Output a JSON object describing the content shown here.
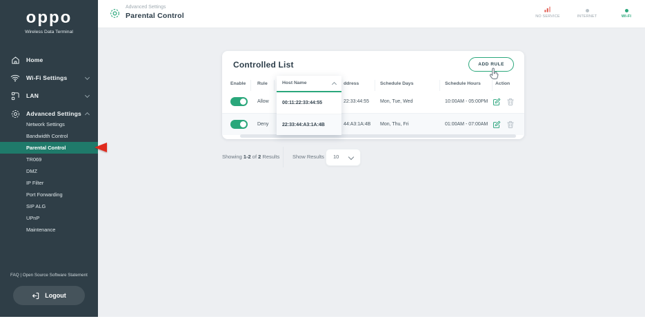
{
  "brand": {
    "logo": "oppo",
    "tagline": "Wireless Data Terminal"
  },
  "header": {
    "breadcrumb": "Advanced Settings",
    "title": "Parental Control",
    "status": [
      {
        "label": "NO SERVICE"
      },
      {
        "label": "INTERNET"
      },
      {
        "label": "WI-FI"
      }
    ]
  },
  "sidebar": {
    "menu": [
      {
        "label": "Home"
      },
      {
        "label": "Wi-Fi Settings"
      },
      {
        "label": "LAN"
      },
      {
        "label": "Advanced Settings"
      }
    ],
    "submenu": [
      {
        "label": "Network Settings"
      },
      {
        "label": "Bandwidth Control"
      },
      {
        "label": "Parental Control",
        "active": true
      },
      {
        "label": "TR069"
      },
      {
        "label": "DMZ"
      },
      {
        "label": "IP Filter"
      },
      {
        "label": "Port Forwarding"
      },
      {
        "label": "SIP ALG"
      },
      {
        "label": "UPnP"
      },
      {
        "label": "Maintenance"
      }
    ],
    "footer_link": "FAQ | Open Source Software Statement",
    "logout_label": "Logout"
  },
  "content": {
    "card_title": "Controlled List",
    "add_rule_label": "ADD RULE",
    "table": {
      "headers": {
        "enable": "Enable",
        "rule": "Rule",
        "host_name": "Host Name",
        "address_clipped": "ddress",
        "schedule_days": "Schedule Days",
        "schedule_hours": "Schedule Hours",
        "action": "Action"
      },
      "rows": [
        {
          "enabled": true,
          "rule": "Allow",
          "host_name": "00:11:22:33:44:55",
          "address_clipped": "22:33:44:55",
          "schedule_days": "Mon, Tue, Wed",
          "schedule_hours": "10:00AM - 05:00PM"
        },
        {
          "enabled": true,
          "rule": "Deny",
          "host_name": "22:33:44:A3:1A:4B",
          "address_clipped": "44:A3:1A:4B",
          "schedule_days": "Mon, Thu, Fri",
          "schedule_hours": "01:00AM - 07:00AM"
        }
      ]
    },
    "pagination": {
      "summary_prefix": "Showing ",
      "summary_range": "1-2",
      "summary_of": " of ",
      "summary_count": "2",
      "summary_suffix": " Results",
      "show_results_label": "Show Results",
      "page_size_value": "10"
    }
  },
  "colors": {
    "accent": "#2aa77b",
    "sidebar_bg": "#2f3e47",
    "active_item_bg": "#1f7a6a",
    "pointer_red": "#e02b1e",
    "status_error": "#e0564b"
  }
}
